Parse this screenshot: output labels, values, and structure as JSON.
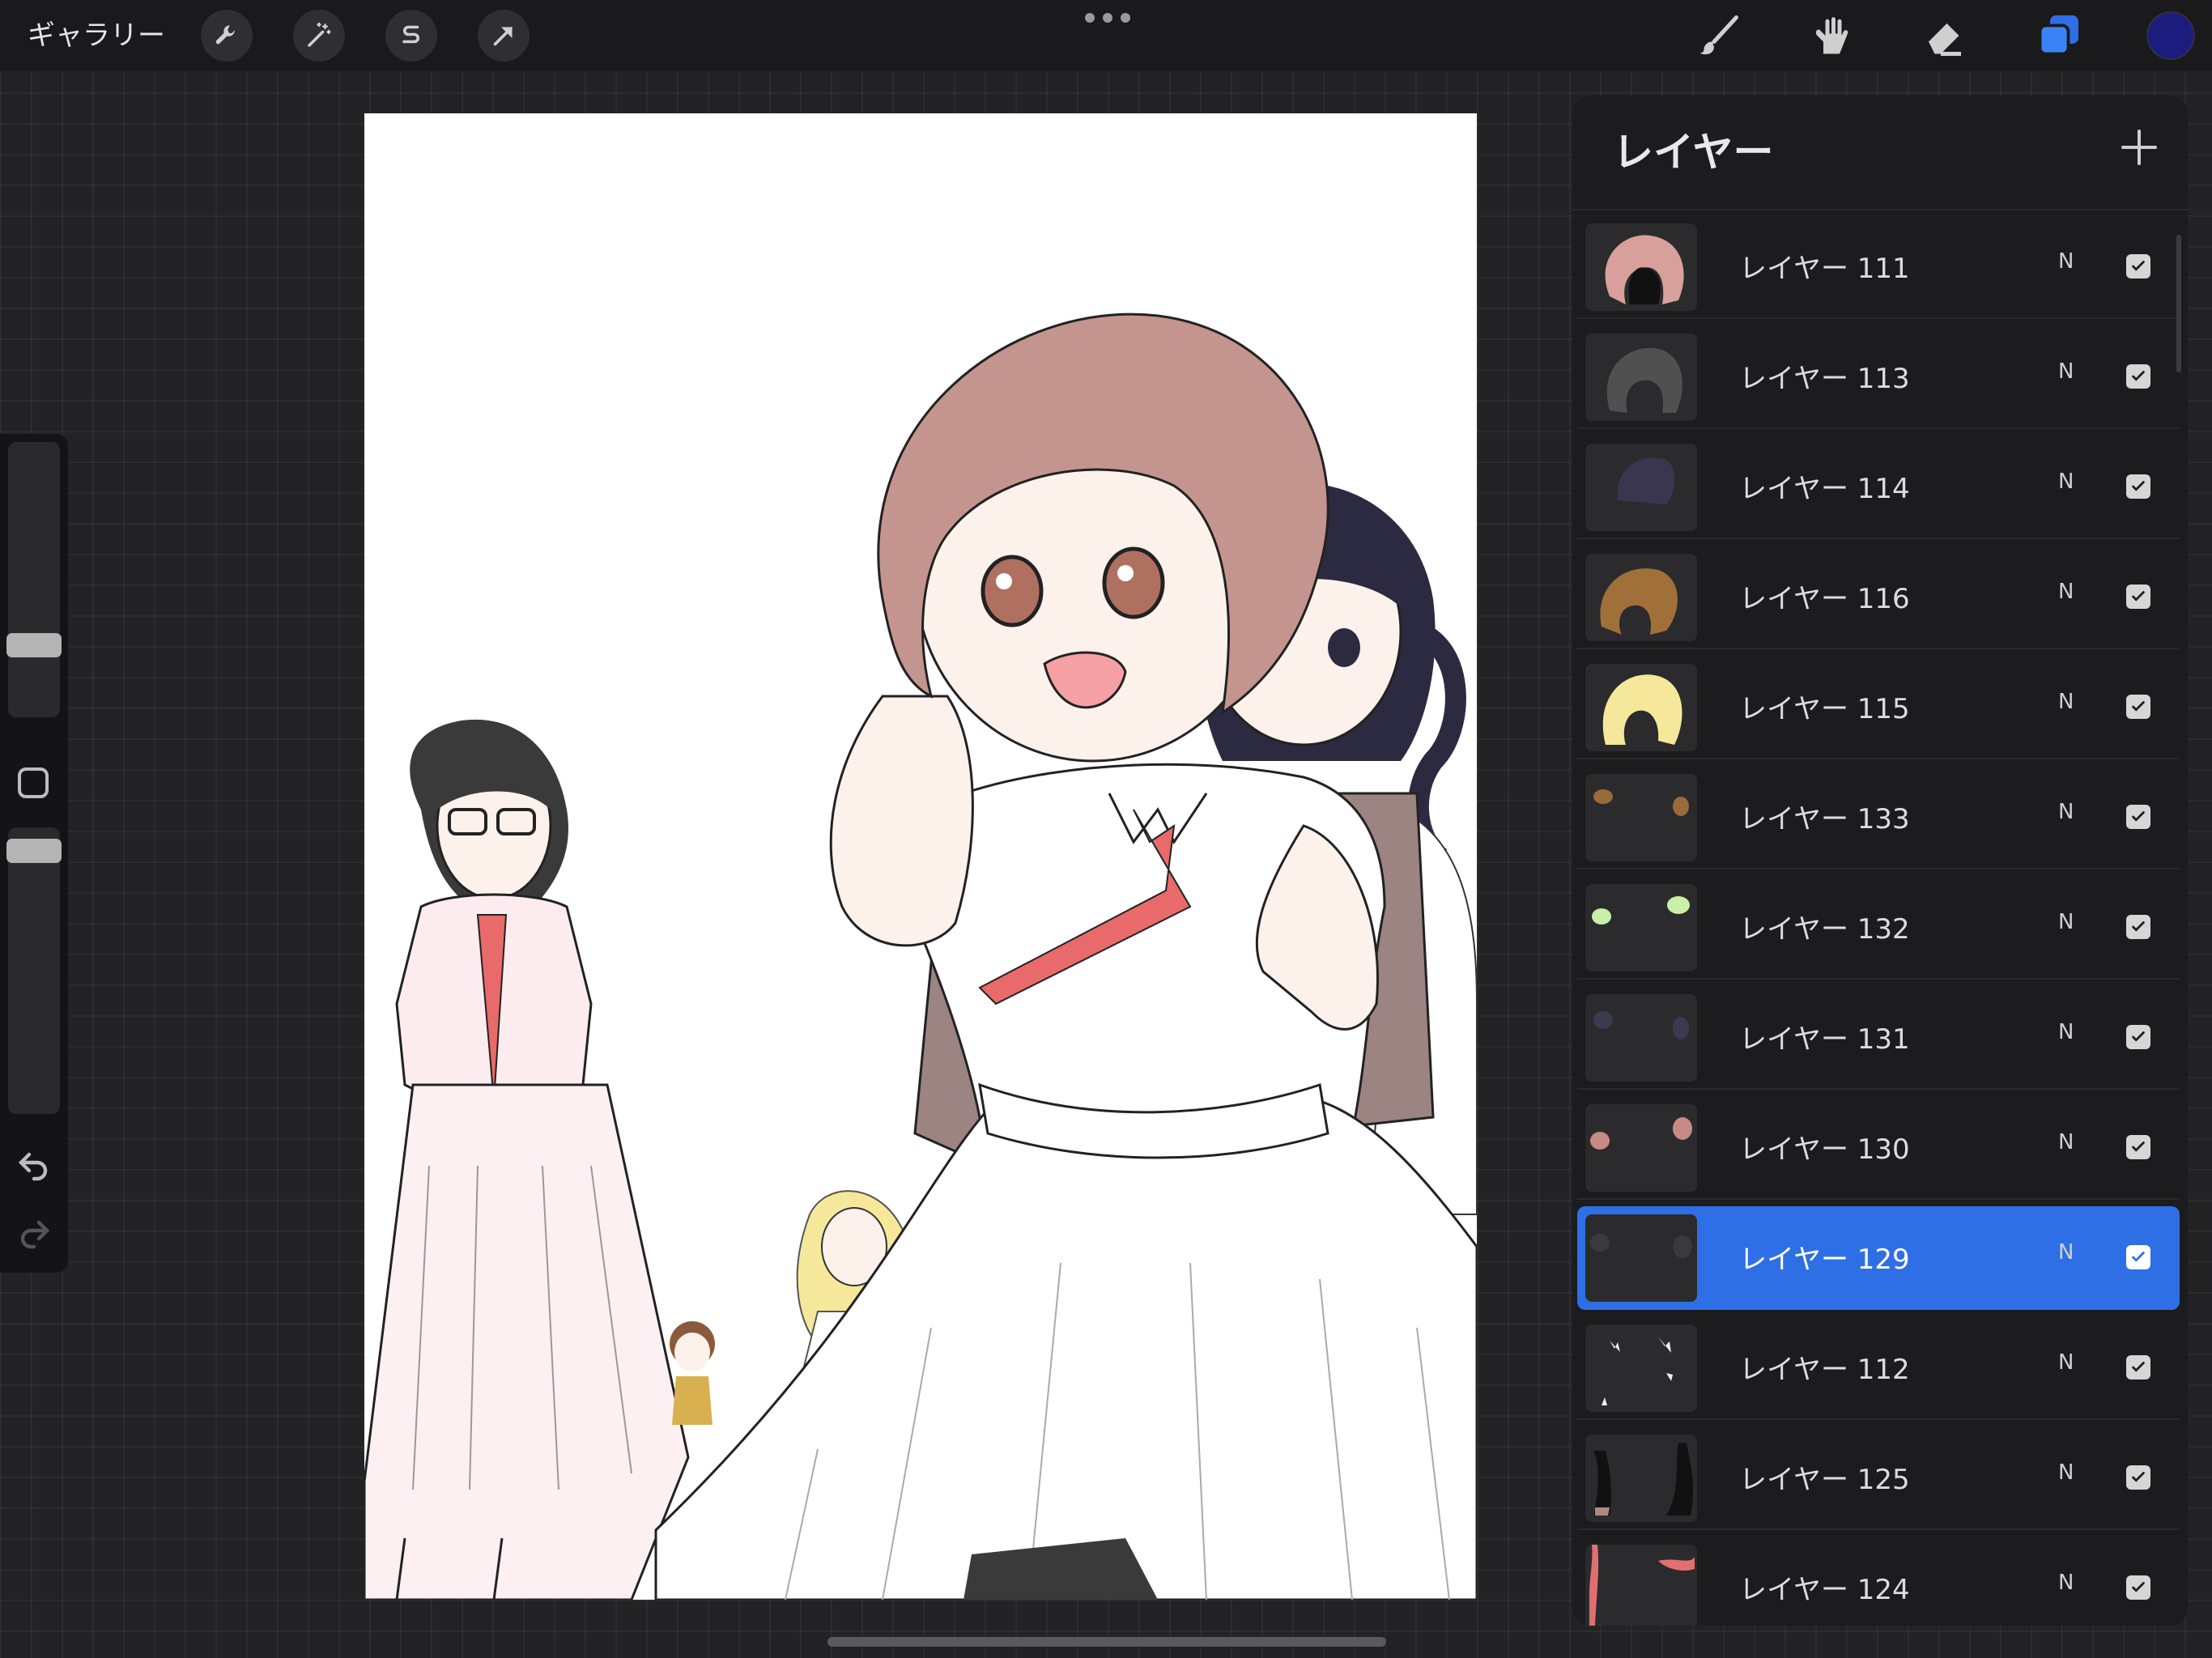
{
  "topbar": {
    "gallery_label": "ギャラリー",
    "left_tools": [
      "wrench-icon",
      "magic-wand-icon",
      "selection-s-icon",
      "transform-arrow-icon"
    ],
    "right_tools": [
      "brush-icon",
      "smudge-icon",
      "eraser-icon",
      "layers-icon"
    ],
    "active_color": "#1c1c7e",
    "accent": "#2f6fe6"
  },
  "sidebar": {
    "size_slider_level": 0.3,
    "opacity_slider_level": 0.95
  },
  "layers_panel": {
    "title": "レイヤー",
    "layers": [
      {
        "name": "レイヤー 111",
        "blend": "N",
        "visible": true,
        "active": false,
        "thumb_color": "#d8a09a"
      },
      {
        "name": "レイヤー 113",
        "blend": "N",
        "visible": true,
        "active": false,
        "thumb_color": "#505050"
      },
      {
        "name": "レイヤー 114",
        "blend": "N",
        "visible": true,
        "active": false,
        "thumb_color": "#3a3650"
      },
      {
        "name": "レイヤー 116",
        "blend": "N",
        "visible": true,
        "active": false,
        "thumb_color": "#a07038"
      },
      {
        "name": "レイヤー 115",
        "blend": "N",
        "visible": true,
        "active": false,
        "thumb_color": "#f6e89a"
      },
      {
        "name": "レイヤー 133",
        "blend": "N",
        "visible": true,
        "active": false,
        "thumb_color": "#9a6a3a"
      },
      {
        "name": "レイヤー 132",
        "blend": "N",
        "visible": true,
        "active": false,
        "thumb_color": "#c8f0a8"
      },
      {
        "name": "レイヤー 131",
        "blend": "N",
        "visible": true,
        "active": false,
        "thumb_color": "#3c3a50"
      },
      {
        "name": "レイヤー 130",
        "blend": "N",
        "visible": true,
        "active": false,
        "thumb_color": "#c88a84"
      },
      {
        "name": "レイヤー 129",
        "blend": "N",
        "visible": true,
        "active": true,
        "thumb_color": "#3a3a3c"
      },
      {
        "name": "レイヤー 112",
        "blend": "N",
        "visible": true,
        "active": false,
        "thumb_color": "#f0f0f0"
      },
      {
        "name": "レイヤー 125",
        "blend": "N",
        "visible": true,
        "active": false,
        "thumb_color": "#b08880"
      },
      {
        "name": "レイヤー 124",
        "blend": "N",
        "visible": true,
        "active": false,
        "thumb_color": "#e07070"
      }
    ]
  }
}
